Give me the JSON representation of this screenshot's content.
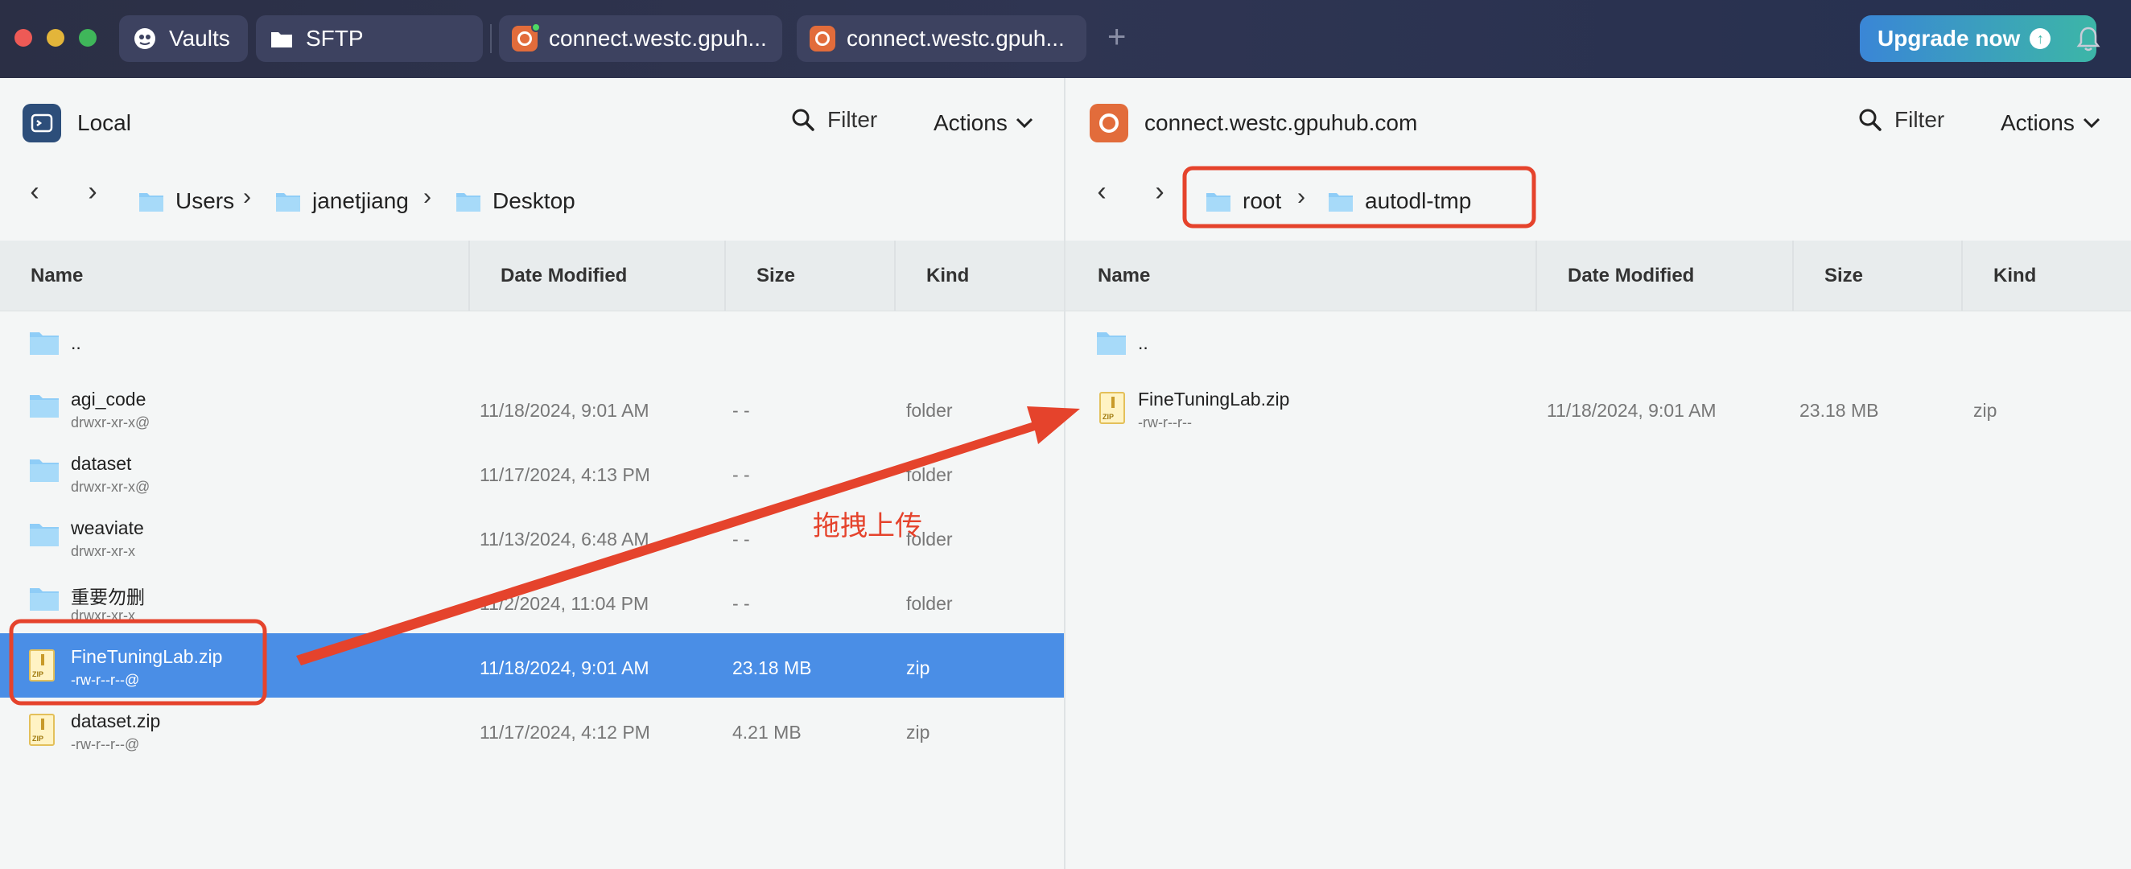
{
  "titlebar": {
    "tabs": [
      {
        "label": "Vaults",
        "icon": "vaults-icon"
      },
      {
        "label": "SFTP",
        "icon": "folder-icon"
      },
      {
        "label": "connect.westc.gpuh...",
        "icon": "ubuntu-icon",
        "status": "online"
      },
      {
        "label": "connect.westc.gpuh...",
        "icon": "ubuntu-icon"
      }
    ],
    "new_tab": "+",
    "upgrade_label": "Upgrade now",
    "colors": {
      "upgrade_start": "#3a86d6",
      "upgrade_end": "#3cb6a7",
      "ubuntu": "#e26c3b"
    }
  },
  "left": {
    "host": "Local",
    "filter_label": "Filter",
    "actions_label": "Actions",
    "breadcrumb": [
      "Users",
      "janetjiang",
      "Desktop"
    ],
    "columns": [
      "Name",
      "Date Modified",
      "Size",
      "Kind"
    ],
    "rows": [
      {
        "name": "..",
        "perm": "",
        "date": "",
        "size": "",
        "kind": "",
        "type": "folder"
      },
      {
        "name": "agi_code",
        "perm": "drwxr-xr-x@",
        "date": "11/18/2024, 9:01 AM",
        "size": "- -",
        "kind": "folder",
        "type": "folder"
      },
      {
        "name": "dataset",
        "perm": "drwxr-xr-x@",
        "date": "11/17/2024, 4:13 PM",
        "size": "- -",
        "kind": "folder",
        "type": "folder"
      },
      {
        "name": "weaviate",
        "perm": "drwxr-xr-x",
        "date": "11/13/2024, 6:48 AM",
        "size": "- -",
        "kind": "folder",
        "type": "folder"
      },
      {
        "name": "重要勿删",
        "perm": "drwxr-xr-x",
        "date": "11/2/2024, 11:04 PM",
        "size": "- -",
        "kind": "folder",
        "type": "folder"
      },
      {
        "name": "FineTuningLab.zip",
        "perm": "-rw-r--r--@",
        "date": "11/18/2024, 9:01 AM",
        "size": "23.18 MB",
        "kind": "zip",
        "type": "zip",
        "selected": true
      },
      {
        "name": "dataset.zip",
        "perm": "-rw-r--r--@",
        "date": "11/17/2024, 4:12 PM",
        "size": "4.21 MB",
        "kind": "zip",
        "type": "zip"
      }
    ]
  },
  "right": {
    "host": "connect.westc.gpuhub.com",
    "filter_label": "Filter",
    "actions_label": "Actions",
    "breadcrumb": [
      "root",
      "autodl-tmp"
    ],
    "columns": [
      "Name",
      "Date Modified",
      "Size",
      "Kind"
    ],
    "rows": [
      {
        "name": "..",
        "perm": "",
        "date": "",
        "size": "",
        "kind": "",
        "type": "folder"
      },
      {
        "name": "FineTuningLab.zip",
        "perm": "-rw-r--r--",
        "date": "11/18/2024, 9:01 AM",
        "size": "23.18 MB",
        "kind": "zip",
        "type": "zip"
      }
    ]
  },
  "annotation": {
    "text": "拖拽上传",
    "color": "#e5432c"
  }
}
